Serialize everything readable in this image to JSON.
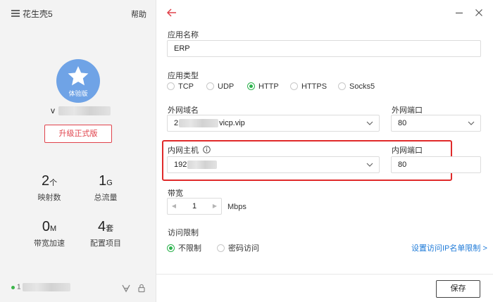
{
  "app": {
    "title": "花生壳5",
    "help_label": "帮助"
  },
  "account": {
    "avatar_badge": "体验版",
    "username_initial": "v",
    "upgrade_label": "升级正式版"
  },
  "stats": [
    {
      "value": "2",
      "unit": "个",
      "label": "映射数"
    },
    {
      "value": "1",
      "unit": "G",
      "label": "总流量"
    },
    {
      "value": "0",
      "unit": "M",
      "label": "带宽加速"
    },
    {
      "value": "4",
      "unit": "套",
      "label": "配置项目"
    }
  ],
  "footer": {
    "ip_prefix": "1"
  },
  "form": {
    "app_name": {
      "label": "应用名称",
      "value": "ERP"
    },
    "app_type": {
      "label": "应用类型",
      "options": [
        "TCP",
        "UDP",
        "HTTP",
        "HTTPS",
        "Socks5"
      ],
      "selected": "HTTP"
    },
    "ext_domain": {
      "label": "外网域名",
      "value_prefix": "2",
      "value_suffix": "vicp.vip"
    },
    "ext_port": {
      "label": "外网端口",
      "value": "80"
    },
    "int_host": {
      "label": "内网主机",
      "value_prefix": "192"
    },
    "int_port": {
      "label": "内网端口",
      "value": "80"
    },
    "bandwidth": {
      "label": "带宽",
      "value": "1",
      "unit": "Mbps"
    },
    "access": {
      "label": "访问限制",
      "options": [
        "不限制",
        "密码访问"
      ],
      "selected": "不限制",
      "ip_link": "设置访问IP名单限制 >"
    },
    "save_label": "保存"
  },
  "colors": {
    "accent_red": "#e0424b",
    "radio_green": "#2bb24c",
    "link_blue": "#1e7ad8",
    "avatar_blue": "#6fa3e6"
  }
}
